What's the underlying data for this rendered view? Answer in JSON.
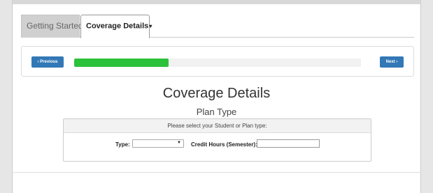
{
  "tabs": [
    {
      "label": "Getting Started",
      "caret": "▾"
    },
    {
      "label": "Coverage Details",
      "caret": "▾"
    }
  ],
  "wizard": {
    "prev_label": "‹ Previous",
    "next_label": "Next ›",
    "progress_fraction": 0.33,
    "progress_color": "#2cc13a",
    "button_color": "#3278b6"
  },
  "main": {
    "title": "Coverage Details",
    "section_title": "Plan Type"
  },
  "form": {
    "instruction": "Please select your Student or Plan type:",
    "type_label": "Type:",
    "type_value": "",
    "type_caret": "▼",
    "hours_label": "Credit Hours (Semester):",
    "hours_value": ""
  }
}
